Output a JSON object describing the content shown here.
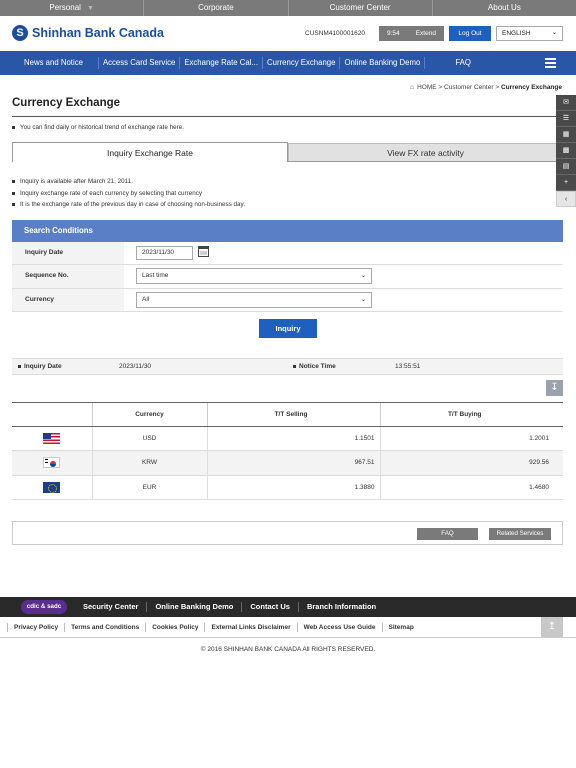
{
  "topbar": {
    "items": [
      "Personal",
      "Corporate",
      "Customer Center",
      "About Us"
    ],
    "personal_caret": "▼"
  },
  "header": {
    "logo_mark": "S",
    "logo_text": "Shinhan Bank Canada",
    "customer_no": "CUSNM4100001620",
    "session_time": "9:54",
    "extend_label": "Extend",
    "logout_label": "Log Out",
    "language": "ENGLISH"
  },
  "nav": {
    "items": [
      "News and Notice",
      "Access Card Service",
      "Exchange Rate Cal...",
      "Currency Exchange",
      "Online Banking Demo",
      "FAQ"
    ]
  },
  "breadcrumb": {
    "home": "HOME",
    "sep": ">",
    "center": "Customer Center",
    "current": "Currency Exchange"
  },
  "page": {
    "title": "Currency Exchange",
    "intro": "You can find daily or historical trend of exchange rate here."
  },
  "tabs": {
    "active": "Inquiry Exchange Rate",
    "inactive": "View FX rate activity"
  },
  "notes": [
    "Inquiry is available after March 21, 2011.",
    "Inquiry exchange rate of each currency by selecting that currency",
    "It is the exchange rate of the previous day in case of choosing non-business day."
  ],
  "search": {
    "heading": "Search Conditions",
    "date_label": "Inquiry Date",
    "date_value": "2023/11/30",
    "seq_label": "Sequence No.",
    "seq_value": "Last time",
    "currency_label": "Currency",
    "currency_value": "All",
    "button": "Inquiry"
  },
  "result_info": {
    "date_label": "Inquiry Date",
    "date_value": "2023/11/30",
    "time_label": "Notice Time",
    "time_value": "13:55:51"
  },
  "table": {
    "headers": [
      "",
      "Currency",
      "T/T Selling",
      "T/T Buying"
    ],
    "rows": [
      {
        "flag": "us-flag-icon",
        "currency": "USD",
        "selling": "1.1501",
        "buying": "1.2001"
      },
      {
        "flag": "kr-flag-icon",
        "currency": "KRW",
        "selling": "967.51",
        "buying": "929.56"
      },
      {
        "flag": "eu-flag-icon",
        "currency": "EUR",
        "selling": "1.3880",
        "buying": "1.4680"
      }
    ]
  },
  "services": {
    "faq": "FAQ",
    "related": "Related Services"
  },
  "quick_menu": [
    "mail-icon",
    "list-icon",
    "calculator-icon",
    "chart-icon",
    "document-icon",
    "plus-icon",
    "chevron-left-icon"
  ],
  "footer": {
    "badge": "cdic & sadc",
    "main_links": [
      "Security Center",
      "Online Banking Demo",
      "Contact Us",
      "Branch Information"
    ],
    "links": [
      "Privacy Policy",
      "Terms and Conditions",
      "Cookies Policy",
      "External Links Disclaimer",
      "Web Access Use Guide",
      "Sitemap"
    ],
    "copyright": "© 2016 SHINHAN BANK CANADA All RIGHTS RESERVED."
  },
  "colors": {
    "brand_blue": "#1a4ea0",
    "nav_blue": "#2a56a8",
    "button_blue": "#1f5fbf",
    "search_head": "#5b7fc7",
    "topbar_gray": "#7a7a7a"
  }
}
